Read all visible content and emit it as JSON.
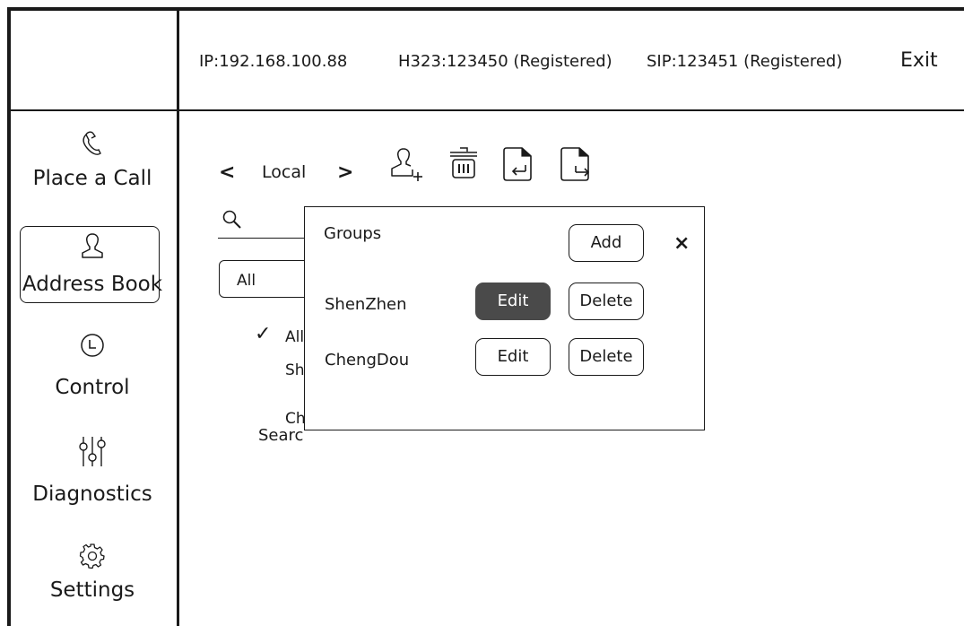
{
  "header": {
    "ip": "IP:192.168.100.88",
    "h323": "H323:123450 (Registered)",
    "sip": "SIP:123451 (Registered)",
    "exit_label": "Exit"
  },
  "sidebar": {
    "items": [
      {
        "label": "Place a Call",
        "icon": "phone-icon"
      },
      {
        "label": "Address Book",
        "icon": "contact-icon",
        "active": true
      },
      {
        "label": "Control",
        "icon": "clock-icon"
      },
      {
        "label": "Diagnostics",
        "icon": "sliders-icon"
      },
      {
        "label": "Settings",
        "icon": "gear-icon"
      }
    ]
  },
  "address_book": {
    "source_label": "Local",
    "search_placeholder": "Searc",
    "filter_value": "All",
    "list_items": [
      "All",
      "Sh",
      "Ch"
    ]
  },
  "groups_dialog": {
    "title": "Groups",
    "add_label": "Add",
    "close_label": "×",
    "groups": [
      {
        "name": "ShenZhen",
        "edit_label": "Edit",
        "delete_label": "Delete",
        "edit_pressed": true
      },
      {
        "name": "ChengDou",
        "edit_label": "Edit",
        "delete_label": "Delete",
        "edit_pressed": false
      }
    ]
  },
  "colors": {
    "line": "#1a1a1a",
    "pressed_button": "#4a4a4a"
  }
}
